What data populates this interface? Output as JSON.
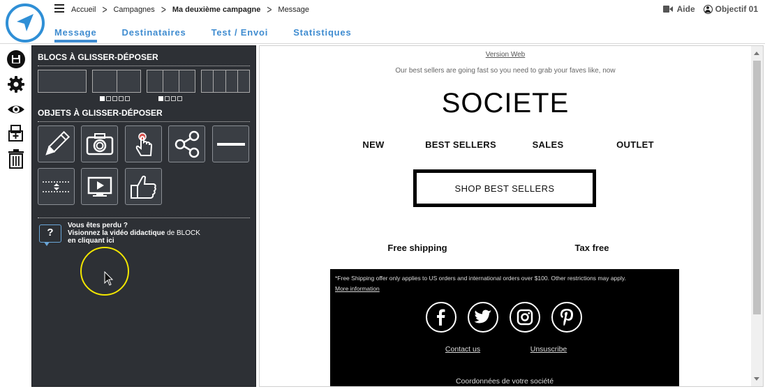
{
  "header": {
    "breadcrumb": [
      "Accueil",
      "Campagnes",
      "Ma deuxième campagne",
      "Message"
    ],
    "help_label": "Aide",
    "user_label": "Objectif 01"
  },
  "tabs": [
    {
      "label": "Message",
      "active": true
    },
    {
      "label": "Destinataires",
      "active": false
    },
    {
      "label": "Test / Envoi",
      "active": false
    },
    {
      "label": "Statistiques",
      "active": false
    }
  ],
  "toolbar": {
    "icons": [
      "save-icon",
      "gear-icon",
      "eye-icon",
      "add-page-icon",
      "trash-icon"
    ]
  },
  "panel": {
    "blocks_title": "BLOCS À GLISSER-DÉPOSER",
    "objects_title": "OBJETS À GLISSER-DÉPOSER",
    "object_icons": [
      "pencil-icon",
      "camera-icon",
      "pointer-hand-icon",
      "share-icon",
      "divider-line-icon",
      "spacer-icon",
      "video-icon",
      "thumbs-up-icon"
    ],
    "help": {
      "line1": "Vous êtes perdu ?",
      "line2_a": "Visionnez la vidéo ",
      "line2_b": "didactique",
      "line2_c": " de BLOCK",
      "line3": "en cliquant ici"
    }
  },
  "email": {
    "version_web": "Version Web",
    "preheader": "Our best sellers are going fast so you need to grab your faves like, now",
    "brand": "SOCIETE",
    "nav": [
      "NEW",
      "BEST SELLERS",
      "SALES",
      "OUTLET"
    ],
    "cta": "SHOP BEST SELLERS",
    "perks": [
      "Free shipping",
      "Tax free"
    ],
    "footer": {
      "note": "*Free Shipping offer only applies to US orders and international orders over $100. Other restrictions may apply.",
      "more": "More information",
      "social_icons": [
        "facebook-icon",
        "twitter-icon",
        "instagram-icon",
        "pinterest-icon"
      ],
      "contact": "Contact us",
      "unsubscribe": "Unsuscribe",
      "address": "Coordonnées de votre société"
    }
  },
  "colors": {
    "accent": "#3f8cd0",
    "panel_bg": "#2d3035",
    "highlight": "#f2e600"
  }
}
